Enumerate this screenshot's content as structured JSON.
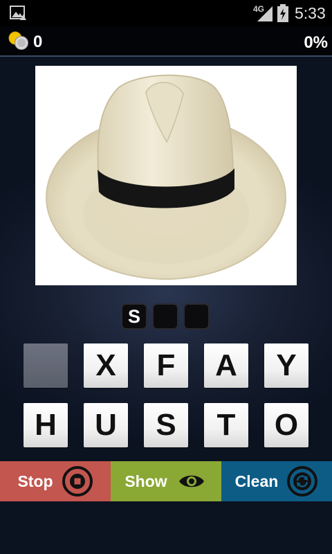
{
  "status_bar": {
    "network": "4G",
    "time": "5:33"
  },
  "game": {
    "coins": "0",
    "progress": "0%",
    "picture_icon": "panama-hat",
    "answer_slots": [
      "S",
      "",
      ""
    ],
    "letters": [
      "",
      "X",
      "F",
      "A",
      "Y",
      "H",
      "U",
      "S",
      "T",
      "O"
    ]
  },
  "actions": {
    "stop_label": "Stop",
    "stop_icon": "stop-circle-icon",
    "show_label": "Show",
    "show_icon": "eye-icon",
    "clean_label": "Clean",
    "clean_icon": "refresh-icon"
  },
  "colors": {
    "stop": "#c3564f",
    "show": "#8aa834",
    "clean": "#0d5c86"
  }
}
